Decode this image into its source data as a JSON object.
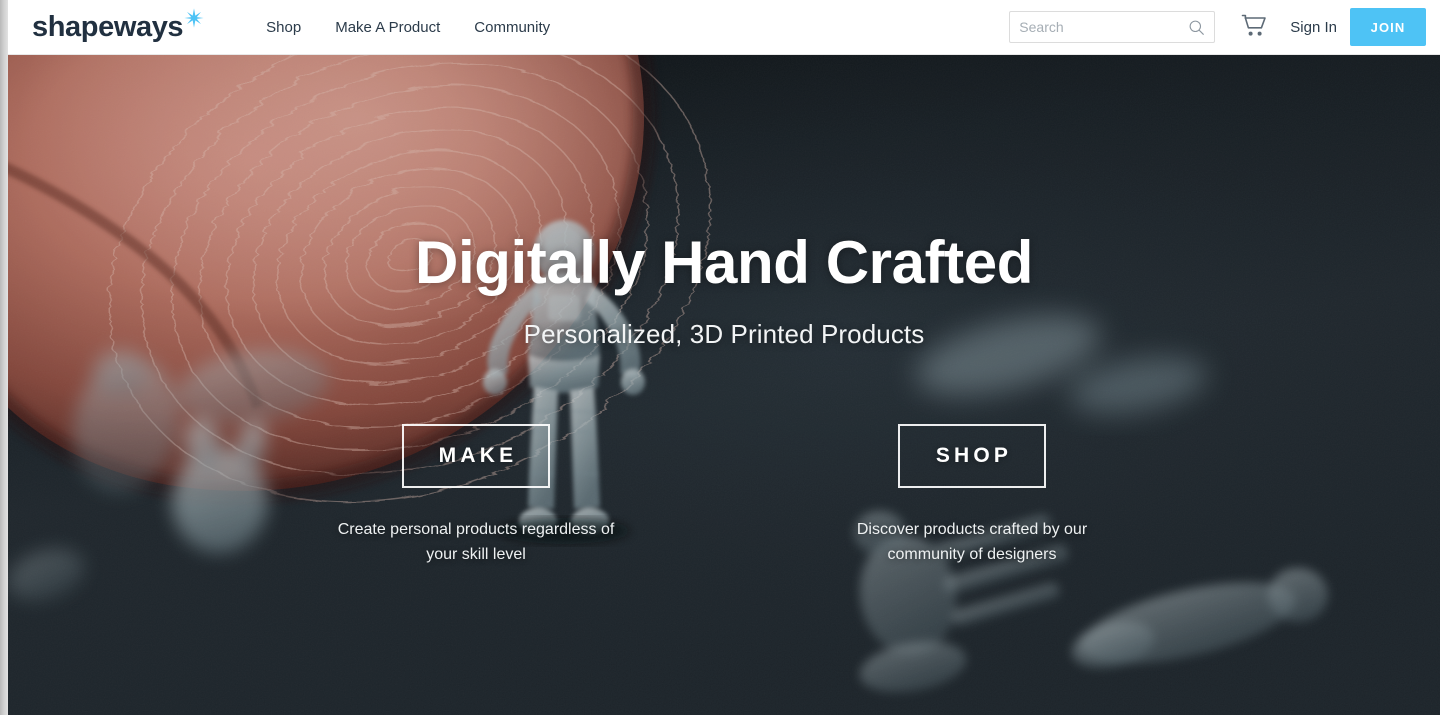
{
  "window": {
    "left_edge_strip": "scrollbar-strip"
  },
  "header": {
    "brand": {
      "word": "shapeways",
      "star_icon": "sparkle-star-icon",
      "word_color": "#213040",
      "star_color": "#4ec3f5"
    },
    "nav": [
      {
        "label": "Shop"
      },
      {
        "label": "Make A Product"
      },
      {
        "label": "Community"
      }
    ],
    "search": {
      "placeholder": "Search",
      "value": "",
      "icon": "search-icon"
    },
    "cart": {
      "icon": "shopping-cart-icon"
    },
    "sign_in": {
      "label": "Sign In"
    },
    "join": {
      "label": "JOIN",
      "color": "#4ec3f5"
    }
  },
  "hero": {
    "title": "Digitally Hand Crafted",
    "subtitle": "Personalized, 3D Printed Products",
    "background_description": "fingertip with 3D printed translucent astronaut figurines on dark fabric",
    "background_color": "#222b33",
    "ctas": [
      {
        "label": "MAKE",
        "caption": "Create personal products regardless of your skill level"
      },
      {
        "label": "SHOP",
        "caption": "Discover products crafted by our community of designers"
      }
    ]
  }
}
